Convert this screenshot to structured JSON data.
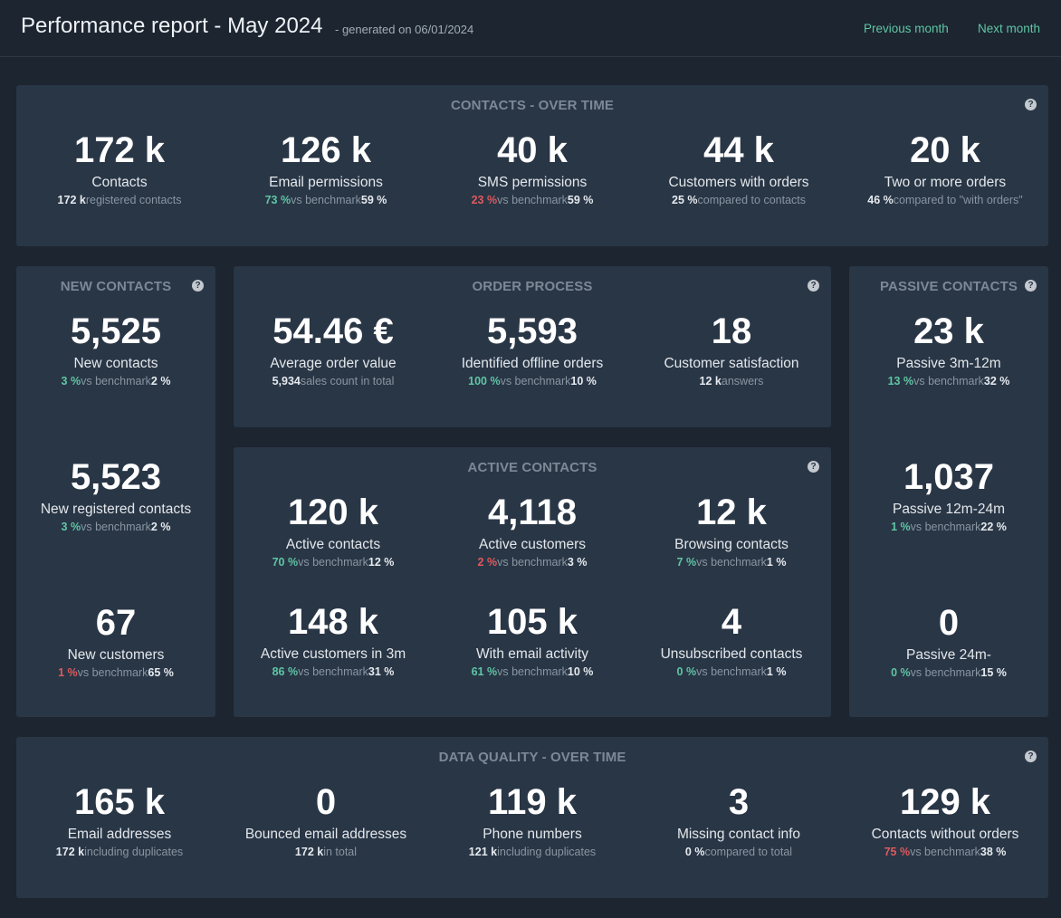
{
  "header": {
    "title": "Performance report - May 2024",
    "subtitle": "- generated on 06/01/2024",
    "prev_label": "Previous month",
    "next_label": "Next month"
  },
  "help_icon": "?",
  "colors": {
    "background": "#1c2530",
    "card": "#293646",
    "positive": "#5fc6a4",
    "negative": "#e0595d",
    "accent": "#5fc6a4"
  },
  "contacts_over_time": {
    "title": "CONTACTS - OVER TIME",
    "metrics": [
      {
        "value": "172 k",
        "label": "Contacts",
        "sub_a": "172 k",
        "sub_b": "registered contacts",
        "sub_c": ""
      },
      {
        "value": "126 k",
        "label": "Email permissions",
        "sub_a": "73 %",
        "sub_b": "vs benchmark",
        "sub_c": "59 %"
      },
      {
        "value": "40 k",
        "label": "SMS permissions",
        "sub_a": "23 %",
        "sub_b": "vs benchmark",
        "sub_c": "59 %"
      },
      {
        "value": "44 k",
        "label": "Customers with orders",
        "sub_a": "25 %",
        "sub_b": "compared to contacts",
        "sub_c": ""
      },
      {
        "value": "20 k",
        "label": "Two or more orders",
        "sub_a": "46 %",
        "sub_b": "compared to \"with orders\"",
        "sub_c": ""
      }
    ]
  },
  "new_contacts": {
    "title": "NEW CONTACTS",
    "metrics": [
      {
        "value": "5,525",
        "label": "New contacts",
        "sub_a": "3 %",
        "sub_b": "vs benchmark",
        "sub_c": "2 %"
      },
      {
        "value": "5,523",
        "label": "New registered contacts",
        "sub_a": "3 %",
        "sub_b": "vs benchmark",
        "sub_c": "2 %"
      },
      {
        "value": "67",
        "label": "New customers",
        "sub_a": "1 %",
        "sub_b": "vs benchmark",
        "sub_c": "65 %"
      }
    ]
  },
  "order_process": {
    "title": "ORDER PROCESS",
    "metrics": [
      {
        "value": "54.46 €",
        "label": "Average order value",
        "sub_a": "5,934",
        "sub_b": "sales count in total",
        "sub_c": ""
      },
      {
        "value": "5,593",
        "label": "Identified offline orders",
        "sub_a": "100 %",
        "sub_b": "vs benchmark",
        "sub_c": "10 %"
      },
      {
        "value": "18",
        "label": "Customer satisfaction",
        "sub_a": "12 k",
        "sub_b": "answers",
        "sub_c": ""
      }
    ]
  },
  "active_contacts": {
    "title": "ACTIVE CONTACTS",
    "metrics": [
      {
        "value": "120 k",
        "label": "Active contacts",
        "sub_a": "70 %",
        "sub_b": "vs benchmark",
        "sub_c": "12 %"
      },
      {
        "value": "4,118",
        "label": "Active customers",
        "sub_a": "2 %",
        "sub_b": "vs benchmark",
        "sub_c": "3 %"
      },
      {
        "value": "12 k",
        "label": "Browsing contacts",
        "sub_a": "7 %",
        "sub_b": "vs benchmark",
        "sub_c": "1 %"
      },
      {
        "value": "148 k",
        "label": "Active customers in 3m",
        "sub_a": "86 %",
        "sub_b": "vs benchmark",
        "sub_c": "31 %"
      },
      {
        "value": "105 k",
        "label": "With email activity",
        "sub_a": "61 %",
        "sub_b": "vs benchmark",
        "sub_c": "10 %"
      },
      {
        "value": "4",
        "label": "Unsubscribed contacts",
        "sub_a": "0 %",
        "sub_b": "vs benchmark",
        "sub_c": "1 %"
      }
    ]
  },
  "passive_contacts": {
    "title": "PASSIVE CONTACTS",
    "metrics": [
      {
        "value": "23 k",
        "label": "Passive 3m-12m",
        "sub_a": "13 %",
        "sub_b": "vs benchmark",
        "sub_c": "32 %"
      },
      {
        "value": "1,037",
        "label": "Passive 12m-24m",
        "sub_a": "1 %",
        "sub_b": "vs benchmark",
        "sub_c": "22 %"
      },
      {
        "value": "0",
        "label": "Passive 24m-",
        "sub_a": "0 %",
        "sub_b": "vs benchmark",
        "sub_c": "15 %"
      }
    ]
  },
  "data_quality": {
    "title": "DATA QUALITY - OVER TIME",
    "metrics": [
      {
        "value": "165 k",
        "label": "Email addresses",
        "sub_a": "172 k",
        "sub_b": "including duplicates",
        "sub_c": ""
      },
      {
        "value": "0",
        "label": "Bounced email addresses",
        "sub_a": "172 k",
        "sub_b": "in total",
        "sub_c": ""
      },
      {
        "value": "119 k",
        "label": "Phone numbers",
        "sub_a": "121 k",
        "sub_b": "including duplicates",
        "sub_c": ""
      },
      {
        "value": "3",
        "label": "Missing contact info",
        "sub_a": "0 %",
        "sub_b": "compared to total",
        "sub_c": ""
      },
      {
        "value": "129 k",
        "label": "Contacts without orders",
        "sub_a": "75 %",
        "sub_b": "vs benchmark",
        "sub_c": "38 %"
      }
    ]
  }
}
